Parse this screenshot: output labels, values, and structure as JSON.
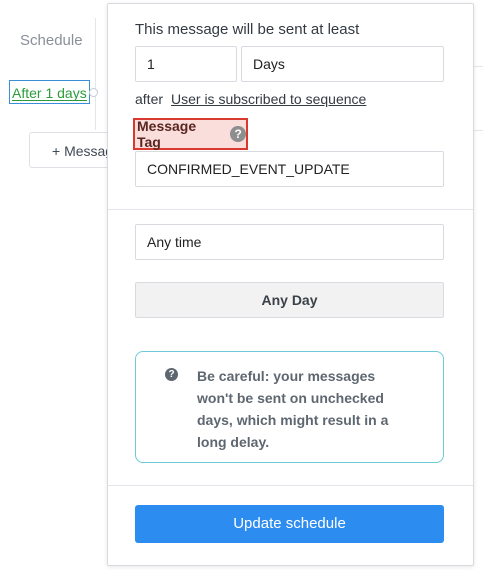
{
  "background": {
    "schedule_label": "Schedule",
    "after_pill_label": "After 1 days",
    "add_message_label": "+ Message"
  },
  "popover": {
    "intro_text": "This message will be sent at least",
    "delay_value": "1",
    "delay_unit": "Days",
    "after_text": "after",
    "trigger_link": "User is subscribed to sequence",
    "message_tag_label": "Message Tag",
    "help_icon": "?",
    "message_tag_value": "CONFIRMED_EVENT_UPDATE",
    "time_value": "Any time",
    "day_button_label": "Any Day",
    "warning_icon": "?",
    "warning_text": "Be careful: your messages won't be sent on unchecked days, which might result in a long delay.",
    "update_button_label": "Update schedule"
  },
  "colors": {
    "primary": "#2d8cf0",
    "highlight_border": "#d93a2f",
    "highlight_fill": "#f9dedb",
    "warning_border": "#6fc9d7",
    "pill_text": "#2a9d3a"
  },
  "icons": {
    "help": "question-circle-icon",
    "warning": "question-circle-icon"
  }
}
